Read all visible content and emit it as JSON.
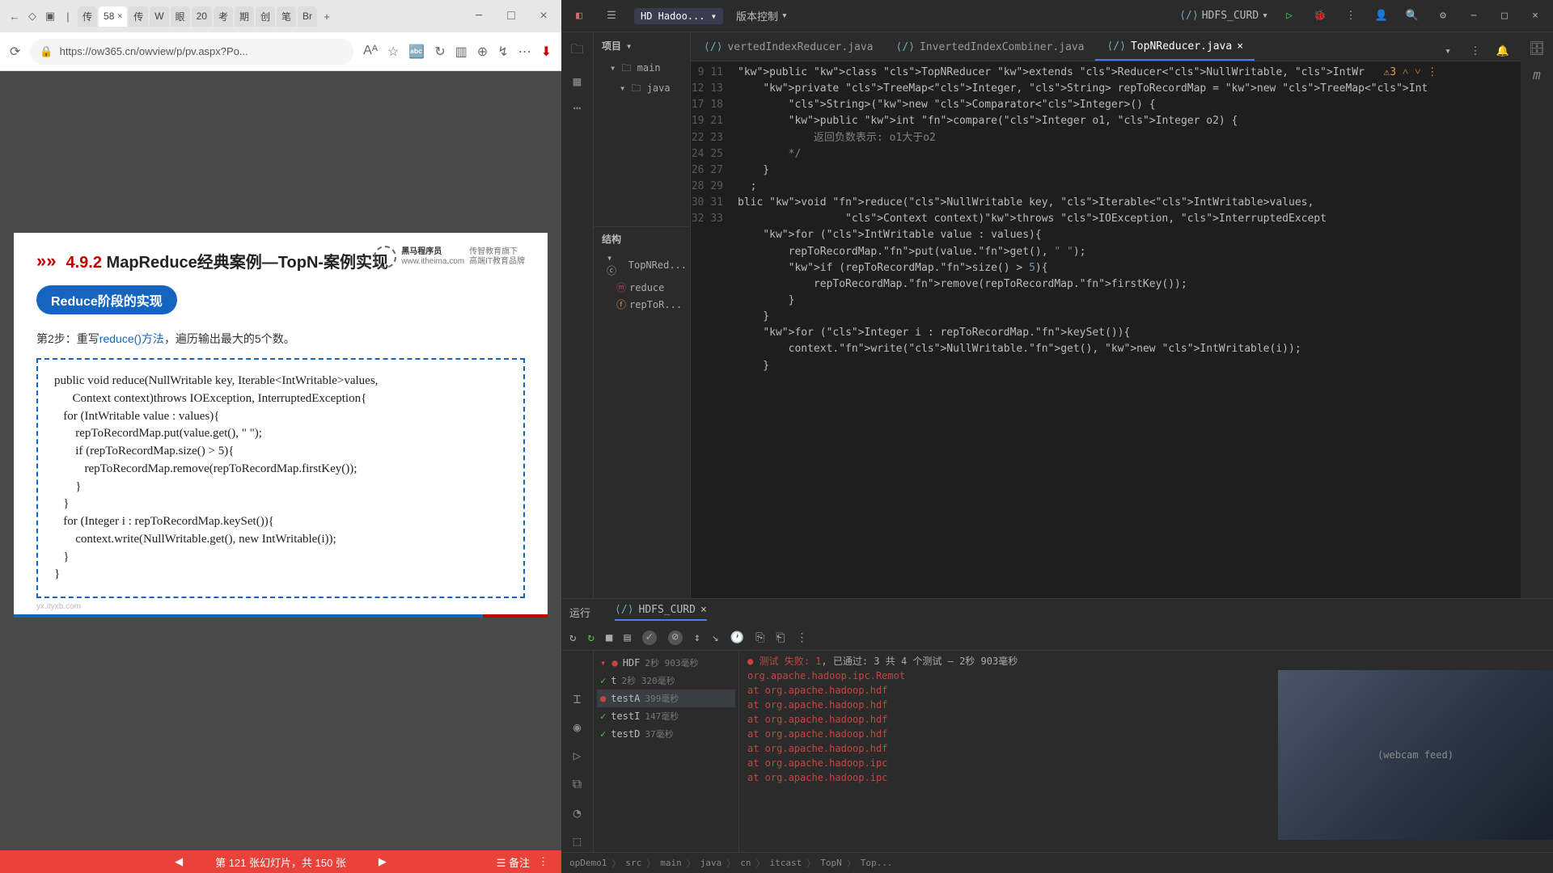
{
  "browser": {
    "tabs": [
      "传",
      "58",
      "传",
      "W",
      "眼",
      "20",
      "考",
      "期",
      "创",
      "笔",
      "Br"
    ],
    "active_tab_index": 1,
    "url": "https://ow365.cn/owview/p/pv.aspx?Po...",
    "window_controls": [
      "−",
      "□",
      "×"
    ]
  },
  "slide": {
    "section_no": "4.9.2",
    "title_main": "MapReduce经典案例—TopN-案例实现",
    "brand_name": "黑马程序员",
    "brand_sub1": "传智教育旗下",
    "brand_sub2": "高端IT教育品牌",
    "brand_site": "www.itheima.com",
    "badge": "Reduce阶段的实现",
    "step_prefix": "第2步：重写",
    "step_link": "reduce()方法",
    "step_suffix": "，遍历输出最大的5个数。",
    "code": "public void reduce(NullWritable key, Iterable<IntWritable>values,\n      Context context)throws IOException, InterruptedException{\n   for (IntWritable value : values){\n       repToRecordMap.put(value.get(), \" \");\n       if (repToRecordMap.size() > 5){\n          repToRecordMap.remove(repToRecordMap.firstKey());\n       }\n   }\n   for (Integer i : repToRecordMap.keySet()){\n       context.write(NullWritable.get(), new IntWritable(i));\n   }\n}",
    "footer": "yx.ityxb.com",
    "nav_prev": "◀",
    "nav_text": "第 121 张幻灯片，共 150 张",
    "nav_next": "▶",
    "nav_note": "☰ 备注",
    "nav_more": "⋮"
  },
  "ide": {
    "topbar": {
      "project_badge": "HD Hadoo...",
      "version_ctrl": "版本控制",
      "run_config": "HDFS_CURD"
    },
    "proj_panel": {
      "title": "项目",
      "items": [
        "main",
        "java"
      ]
    },
    "struct_panel": {
      "title": "结构",
      "root": "TopNRed...",
      "members": [
        "reduce",
        "repToR..."
      ]
    },
    "tabs": [
      "vertedIndexReducer.java",
      "InvertedIndexCombiner.java",
      "TopNReducer.java"
    ],
    "active_tab": 2,
    "gutter": [
      "9",
      "11",
      "12",
      "13",
      "17",
      "18",
      "19",
      "",
      "21",
      "22",
      "23",
      "24",
      "25",
      "26",
      "27",
      "28",
      "29",
      "30",
      "31",
      "32",
      "33"
    ],
    "code_lines": [
      {
        "raw": "public class TopNReducer extends Reducer<NullWritable, IntWr",
        "warn": "⚠3"
      },
      {
        "raw": "    private TreeMap<Integer, String> repToRecordMap = new TreeMap<Int"
      },
      {
        "raw": "        String>(new Comparator<Integer>() {"
      },
      {
        "raw": "        public int compare(Integer o1, Integer o2) {"
      },
      {
        "raw": "            返回负数表示: o1大于o2"
      },
      {
        "raw": "        */"
      },
      {
        "raw": "    }"
      },
      {
        "raw": "  ;"
      },
      {
        "raw": "blic void reduce(NullWritable key, Iterable<IntWritable>values,"
      },
      {
        "raw": "                 Context context)throws IOException, InterruptedExcept"
      },
      {
        "raw": "    for (IntWritable value : values){"
      },
      {
        "raw": "        repToRecordMap.put(value.get(), \" \");"
      },
      {
        "raw": "        if (repToRecordMap.size() > 5){"
      },
      {
        "raw": "            repToRecordMap.remove(repToRecordMap.firstKey());"
      },
      {
        "raw": "        }"
      },
      {
        "raw": "    }"
      },
      {
        "raw": "    for (Integer i : repToRecordMap.keySet()){"
      },
      {
        "raw": "        context.write(NullWritable.get(), new IntWritable(i));"
      },
      {
        "raw": "    }"
      },
      {
        "raw": ""
      },
      {
        "raw": ""
      }
    ],
    "run_panel": {
      "tab_run": "运行",
      "tab_config": "HDFS_CURD",
      "summary_fail_lbl": "测试 失败:",
      "summary_fail_n": "1",
      "summary_pass": ", 已通过: 3 共 4 个测试 – 2秒 903毫秒",
      "tests": [
        {
          "name": "HDF",
          "time": "2秒 903毫秒",
          "status": "fail_parent"
        },
        {
          "name": "t",
          "time": "2秒 320毫秒",
          "status": "pass"
        },
        {
          "name": "testA",
          "time": "399毫秒",
          "status": "fail",
          "sel": true
        },
        {
          "name": "testI",
          "time": "147毫秒",
          "status": "pass"
        },
        {
          "name": "testD",
          "time": "37毫秒",
          "status": "pass"
        }
      ],
      "console": [
        "org.apache.hadoop.ipc.Remot",
        "    at org.apache.hadoop.hdf",
        "    at org.apache.hadoop.hdf",
        "    at org.apache.hadoop.hdf",
        "    at org.apache.hadoop.hdf",
        "    at org.apache.hadoop.hdf",
        "    at org.apache.hadoop.ipc",
        "    at org.apache.hadoop.ipc"
      ]
    },
    "breadcrumb": [
      "opDemo1",
      "src",
      "main",
      "java",
      "cn",
      "itcast",
      "TopN",
      "Top..."
    ]
  }
}
